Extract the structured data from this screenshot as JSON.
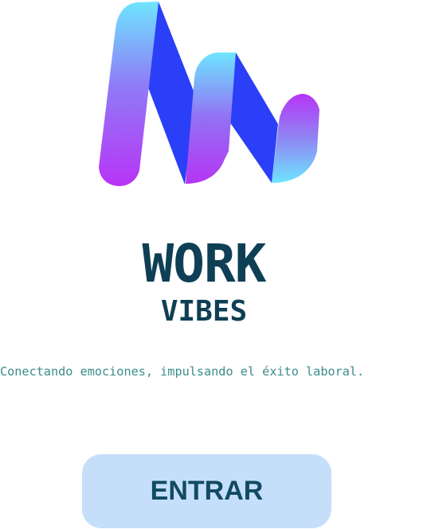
{
  "brand": {
    "logo_icon": "wave-m-logo-icon",
    "title_main": "WORK",
    "title_sub": "VIBES",
    "tagline": "Conectando emociones, impulsando el éxito laboral."
  },
  "actions": {
    "enter_label": "ENTRAR"
  },
  "colors": {
    "title": "#0e3f55",
    "tagline": "#3a8d8a",
    "button_bg": "#c5dffb",
    "button_text": "#124a63",
    "logo_cyan": "#6ee1ff",
    "logo_violet": "#a13ff2",
    "logo_blue": "#2a3ff7"
  }
}
